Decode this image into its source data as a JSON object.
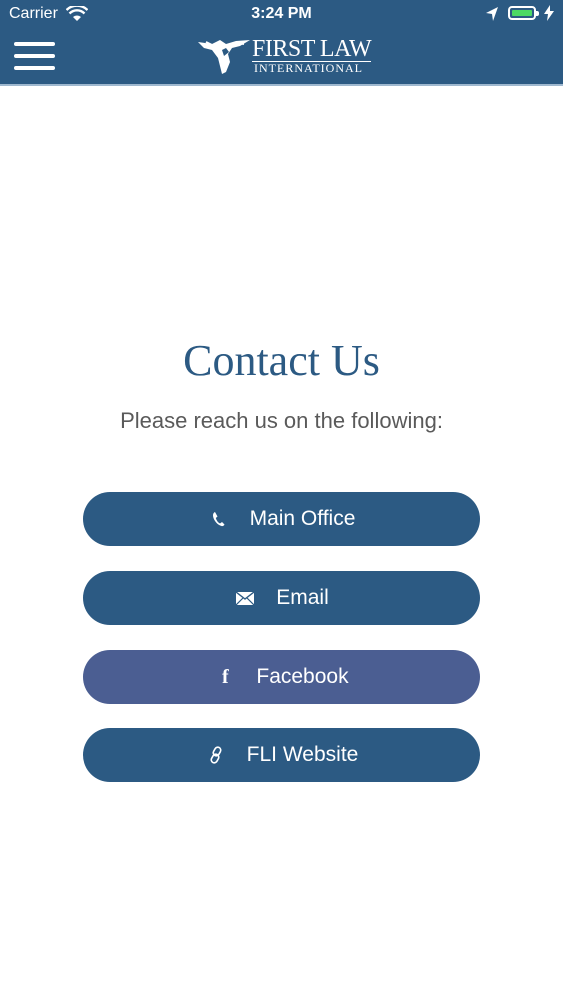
{
  "status_bar": {
    "carrier": "Carrier",
    "time": "3:24 PM",
    "battery_color": "#4cd964"
  },
  "header": {
    "background": "#2c5a83",
    "logo_top": "FIRST LAW",
    "logo_bottom": "INTERNATIONAL",
    "menu_icon": "hamburger-menu-icon"
  },
  "main": {
    "title": "Contact Us",
    "subtitle": "Please reach us on the following:"
  },
  "buttons": [
    {
      "label": "Main Office",
      "icon": "phone-icon",
      "color": "#2c5a83"
    },
    {
      "label": "Email",
      "icon": "envelope-icon",
      "color": "#2c5a83"
    },
    {
      "label": "Facebook",
      "icon": "facebook-icon",
      "color": "#4b5e92"
    },
    {
      "label": "FLI Website",
      "icon": "link-icon",
      "color": "#2c5a83"
    }
  ]
}
